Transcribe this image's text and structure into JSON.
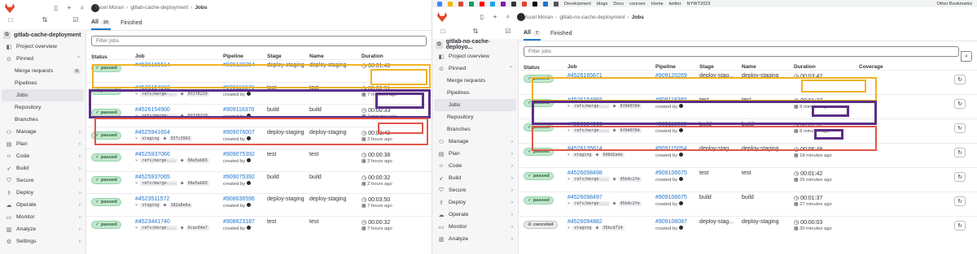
{
  "left": {
    "breadcrumb": [
      "Yucel Moran",
      "gitlab-cache-deployment",
      "Jobs"
    ],
    "project": "gitlab-cache-deployment",
    "sidebar": [
      {
        "label": "Project overview",
        "icon": "project-icon"
      },
      {
        "label": "Pinned",
        "icon": "pin-icon",
        "chevron": "^"
      },
      {
        "label": "Merge requests",
        "badge": "0",
        "sub": true
      },
      {
        "label": "Pipelines",
        "sub": true
      },
      {
        "label": "Jobs",
        "sub": true,
        "active": true
      },
      {
        "label": "Repository",
        "sub": true
      },
      {
        "label": "Branches",
        "sub": true
      },
      {
        "label": "Manage",
        "icon": "users-icon",
        "chevron": ">"
      },
      {
        "label": "Plan",
        "icon": "plan-icon",
        "chevron": ">"
      },
      {
        "label": "Code",
        "icon": "code-icon",
        "chevron": ">"
      },
      {
        "label": "Build",
        "icon": "rocket-icon",
        "chevron": ">"
      },
      {
        "label": "Secure",
        "icon": "shield-icon",
        "chevron": ">"
      },
      {
        "label": "Deploy",
        "icon": "deploy-icon",
        "chevron": ">"
      },
      {
        "label": "Operate",
        "icon": "cloud-icon",
        "chevron": ">"
      },
      {
        "label": "Monitor",
        "icon": "monitor-icon",
        "chevron": ">"
      },
      {
        "label": "Analyze",
        "icon": "chart-icon",
        "chevron": ">"
      },
      {
        "label": "Settings",
        "icon": "gear-icon",
        "chevron": ">"
      }
    ],
    "tabs": [
      {
        "label": "All",
        "count": "20"
      },
      {
        "label": "Finished",
        "count": ""
      }
    ],
    "filter_placeholder": "Filter jobs",
    "headers": [
      "Status",
      "Job",
      "Pipeline",
      "Stage",
      "Name",
      "Duration"
    ],
    "rows": [
      {
        "status": "passed",
        "job": "#4526165614",
        "ref": "",
        "sha": "",
        "pipeline": "#909120254",
        "created": "",
        "stage": "deploy-staging",
        "name": "deploy-staging",
        "duration": "00:01:46",
        "ago": ""
      },
      {
        "status": "passed",
        "job": "#4526154902",
        "ref": "refs/merge-...",
        "sha": "0f2f6229",
        "pipeline": "#909118370",
        "created": "created by",
        "stage": "test",
        "name": "test",
        "duration": "00:00:31",
        "ago": "7 minutes ago"
      },
      {
        "status": "passed",
        "job": "#4526154900",
        "ref": "refs/merge-...",
        "sha": "0f2f6229",
        "pipeline": "#909118370",
        "created": "created by",
        "stage": "build",
        "name": "build",
        "duration": "00:00:33",
        "ago": "7 minutes ago"
      },
      {
        "status": "passed",
        "job": "#4525941654",
        "ref": "staging",
        "sha": "557c3992",
        "pipeline": "#909076007",
        "created": "created by",
        "stage": "deploy-staging",
        "name": "deploy-staging",
        "duration": "00:03:42",
        "ago": "2 hours ago"
      },
      {
        "status": "passed",
        "job": "#4525937066",
        "ref": "refs/merge-...",
        "sha": "66e5ab83",
        "pipeline": "#909075392",
        "created": "created by",
        "stage": "test",
        "name": "test",
        "duration": "00:00:38",
        "ago": "2 hours ago"
      },
      {
        "status": "passed",
        "job": "#4525937065",
        "ref": "refs/merge-...",
        "sha": "66e5ab83",
        "pipeline": "#909075392",
        "created": "created by",
        "stage": "build",
        "name": "build",
        "duration": "00:00:32",
        "ago": "2 hours ago"
      },
      {
        "status": "passed",
        "job": "#4523511572",
        "ref": "staging",
        "sha": "182a6e6a",
        "pipeline": "#908636596",
        "created": "created by",
        "stage": "deploy-staging",
        "name": "deploy-staging",
        "duration": "00:03:50",
        "ago": "7 hours ago"
      },
      {
        "status": "passed",
        "job": "#4523441740",
        "ref": "refs/merge-...",
        "sha": "6cac64e7",
        "pipeline": "#908623187",
        "created": "created by",
        "stage": "test",
        "name": "test",
        "duration": "00:00:32",
        "ago": "7 hours ago"
      }
    ]
  },
  "right": {
    "bookmarks": [
      "Development",
      "blogs",
      "Docs",
      "courses",
      "Home",
      "twitter",
      "NYWT2023",
      "Other Bookmarks"
    ],
    "breadcrumb": [
      "Yucel Moran",
      "gitlab-no-cache-deployment",
      "Jobs"
    ],
    "project": "gitlab-no-cache-deployo...",
    "sidebar": [
      {
        "label": "Project overview",
        "icon": "project-icon"
      },
      {
        "label": "Pinned",
        "icon": "pin-icon",
        "chevron": "^"
      },
      {
        "label": "Merge requests",
        "sub": true
      },
      {
        "label": "Pipelines",
        "sub": true
      },
      {
        "label": "Jobs",
        "sub": true,
        "active": true
      },
      {
        "label": "Repository",
        "sub": true
      },
      {
        "label": "Branches",
        "sub": true
      },
      {
        "label": "Manage",
        "icon": "users-icon",
        "chevron": ">"
      },
      {
        "label": "Plan",
        "icon": "plan-icon",
        "chevron": ">"
      },
      {
        "label": "Code",
        "icon": "code-icon",
        "chevron": ">"
      },
      {
        "label": "Build",
        "icon": "rocket-icon",
        "chevron": ">"
      },
      {
        "label": "Secure",
        "icon": "shield-icon",
        "chevron": ">"
      },
      {
        "label": "Deploy",
        "icon": "deploy-icon",
        "chevron": ">"
      },
      {
        "label": "Operate",
        "icon": "cloud-icon",
        "chevron": ">"
      },
      {
        "label": "Monitor",
        "icon": "monitor-icon",
        "chevron": ">"
      },
      {
        "label": "Analyze",
        "icon": "chart-icon",
        "chevron": ">"
      }
    ],
    "tabs": [
      {
        "label": "All",
        "count": "7"
      },
      {
        "label": "Finished",
        "count": ""
      }
    ],
    "filter_placeholder": "Filter jobs",
    "headers": [
      "Status",
      "Job",
      "Pipeline",
      "Stage",
      "Name",
      "Duration",
      "Coverage"
    ],
    "rows": [
      {
        "status": "passed",
        "job": "#4526165671",
        "ref": "",
        "sha": "",
        "pipeline": "#909120269",
        "created": "",
        "stage": "deploy-stag...",
        "name": "deploy-staging",
        "duration": "00:03:42",
        "ago": ""
      },
      {
        "status": "passed",
        "job": "#4526154968",
        "ref": "refs/merge-...",
        "sha": "8f840784",
        "pipeline": "#909118380",
        "created": "created by",
        "stage": "test",
        "name": "test",
        "duration": "00:01:37",
        "ago": "8 minutes ago"
      },
      {
        "status": "passed",
        "job": "#4526154966",
        "ref": "refs/merge-...",
        "sha": "8f840784",
        "pipeline": "#909118380",
        "created": "created by",
        "stage": "build",
        "name": "build",
        "duration": "00:01:37",
        "ago": "8 minutes ago"
      },
      {
        "status": "passed",
        "job": "#4526135614",
        "ref": "staging",
        "sha": "648d2ade",
        "pipeline": "#909115054",
        "created": "created by",
        "stage": "deploy-stag...",
        "name": "deploy-staging",
        "duration": "00:06:48",
        "ago": "18 minutes ago"
      },
      {
        "status": "passed",
        "job": "#4526098498",
        "ref": "refs/merge-...",
        "sha": "45b4c2fe",
        "pipeline": "#909106675",
        "created": "created by",
        "stage": "test",
        "name": "test",
        "duration": "00:01:42",
        "ago": "25 minutes ago"
      },
      {
        "status": "passed",
        "job": "#4526098497",
        "ref": "refs/merge-...",
        "sha": "45b4c2fe",
        "pipeline": "#909106675",
        "created": "created by",
        "stage": "build",
        "name": "build",
        "duration": "00:01:37",
        "ago": "27 minutes ago"
      },
      {
        "status": "canceled",
        "job": "#4526094882",
        "ref": "staging",
        "sha": "35bcd714",
        "pipeline": "#909106087",
        "created": "created by",
        "stage": "deploy-stag...",
        "name": "deploy-staging",
        "duration": "00:00:03",
        "ago": "30 minutes ago"
      }
    ]
  },
  "colors": {
    "highlight_orange": "#f0b224",
    "highlight_purple": "#5c2f87",
    "highlight_red": "#e0574a",
    "link": "#1f75cb",
    "passed_bg": "#c3e6cd"
  }
}
